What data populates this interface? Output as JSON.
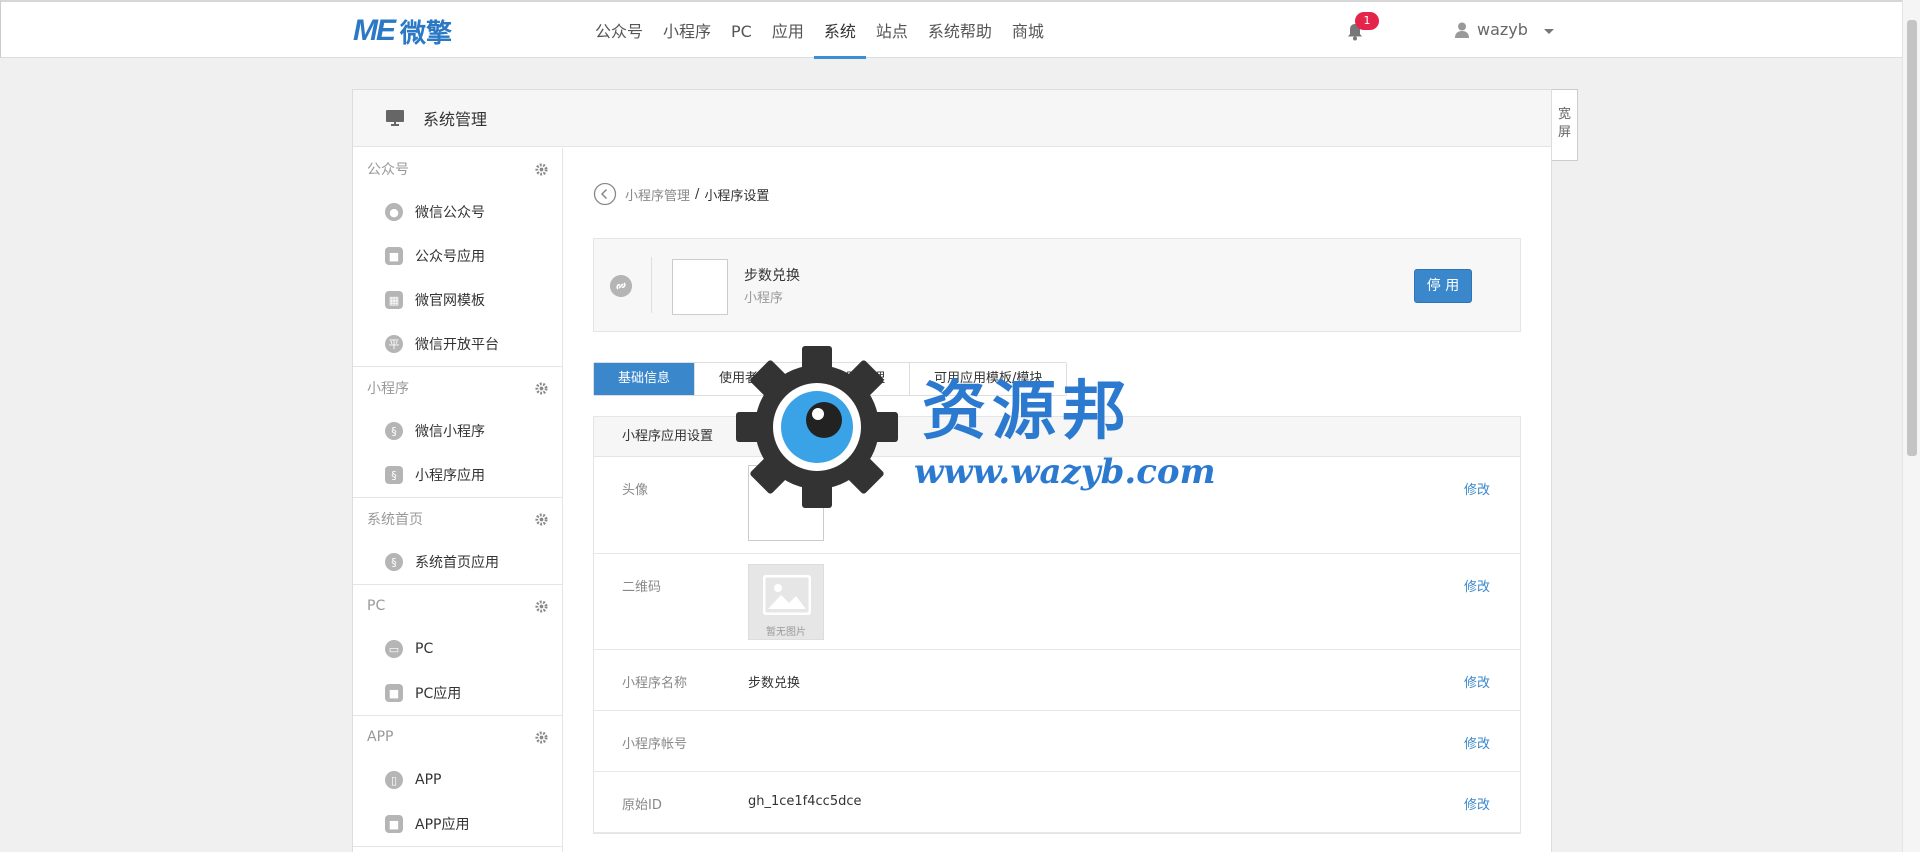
{
  "header": {
    "logo_mark": "ME",
    "logo_text": "微擎",
    "nav": [
      "公众号",
      "小程序",
      "PC",
      "应用",
      "系统",
      "站点",
      "系统帮助",
      "商城"
    ],
    "active_nav": "系统",
    "notification_count": "1",
    "username": "wazyb"
  },
  "panel": {
    "title": "系统管理",
    "wide_label": "宽屏"
  },
  "sidebar": {
    "groups": [
      {
        "title": "公众号",
        "items": [
          "微信公众号",
          "公众号应用",
          "微官网模板",
          "微信开放平台"
        ]
      },
      {
        "title": "小程序",
        "items": [
          "微信小程序",
          "小程序应用"
        ]
      },
      {
        "title": "系统首页",
        "items": [
          "系统首页应用"
        ]
      },
      {
        "title": "PC",
        "items": [
          "PC",
          "PC应用"
        ]
      },
      {
        "title": "APP",
        "items": [
          "APP",
          "APP应用"
        ]
      }
    ]
  },
  "breadcrumb": {
    "parent": "小程序管理",
    "separator": "/",
    "current": "小程序设置"
  },
  "app_card": {
    "name": "步数兑换",
    "type": "小程序",
    "disable_label": "停 用"
  },
  "tabs": [
    "基础信息",
    "使用者管理",
    "权限管理",
    "可用应用模板/模块"
  ],
  "active_tab": "基础信息",
  "settings": {
    "title": "小程序应用设置",
    "edit_label": "修改",
    "no_image_text": "暂无图片",
    "rows": {
      "avatar": {
        "label": "头像"
      },
      "qrcode": {
        "label": "二维码"
      },
      "name": {
        "label": "小程序名称",
        "value": "步数兑换"
      },
      "account": {
        "label": "小程序帐号",
        "value": ""
      },
      "original_id": {
        "label": "原始ID",
        "value": "gh_1ce1f4cc5dce"
      }
    }
  },
  "watermark": {
    "title": "资源邦",
    "url": "www.wazyb.com"
  },
  "colors": {
    "accent": "#3a87cc",
    "badge": "#e4244b",
    "watermark": "#2c7ad0"
  }
}
